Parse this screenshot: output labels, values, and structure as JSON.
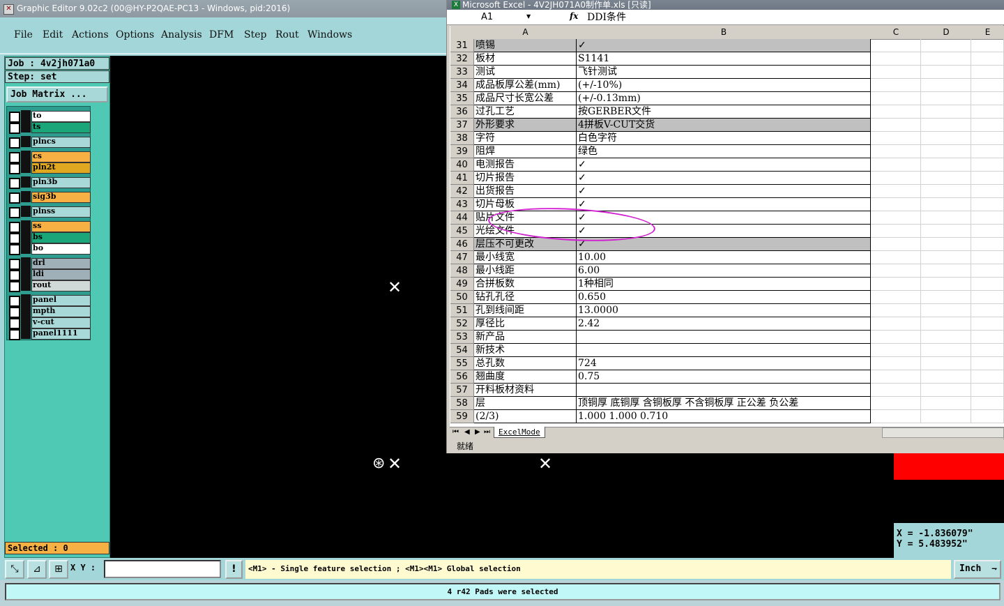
{
  "ge": {
    "title": "Graphic Editor 9.02c2 (00@HY-P2QAE-PC13 - Windows, pid:2016)",
    "menu": [
      "File",
      "Edit",
      "Actions",
      "Options",
      "Analysis",
      "DFM",
      "Step",
      "Rout",
      "Windows"
    ],
    "job": "Job : 4v2jh071a0",
    "step": "Step: set",
    "job_matrix": "Job Matrix ...",
    "layers": [
      {
        "name": "to",
        "color": "#ffffff"
      },
      {
        "name": "ts",
        "color": "#1aa678"
      },
      {
        "name": "plncs",
        "color": "#a8d8d8"
      },
      {
        "name": "cs",
        "color": "#f7b043"
      },
      {
        "name": "pln2t",
        "color": "#e0a820"
      },
      {
        "name": "pln3b",
        "color": "#a8d8d8"
      },
      {
        "name": "sig3b",
        "color": "#f7b043"
      },
      {
        "name": "plnss",
        "color": "#a8d8d8"
      },
      {
        "name": "ss",
        "color": "#f7b043"
      },
      {
        "name": "bs",
        "color": "#1aa678"
      },
      {
        "name": "bo",
        "color": "#ffffff"
      },
      {
        "name": "drl",
        "color": "#a0b0b8"
      },
      {
        "name": "ldi",
        "color": "#a0b0b8"
      },
      {
        "name": "rout",
        "color": "#d0d8d8"
      },
      {
        "name": "panel",
        "color": "#a8d8d8"
      },
      {
        "name": "mpth",
        "color": "#a8d8d8"
      },
      {
        "name": "v-cut",
        "color": "#a8d8d8"
      },
      {
        "name": "panel1111",
        "color": "#a8d8d8"
      }
    ],
    "selected": "Selected : 0",
    "xy_label": "X Y :",
    "hint": "<M1> - Single feature selection ; <M1><M1> Global selection",
    "units": "Inch",
    "message": "4 r42 Pads were selected",
    "coord_x": "X = -1.836079\"",
    "coord_y": "Y = 5.483952\""
  },
  "excel": {
    "title": "Microsoft Excel - 4V2JH071A0制作单.xls [只读]",
    "namebox": "A1",
    "formula": "DDI条件",
    "columns": [
      "A",
      "B",
      "C",
      "D",
      "E"
    ],
    "rows": [
      {
        "n": "31",
        "a": "喷锡",
        "b": "✓",
        "gray": true
      },
      {
        "n": "32",
        "a": "板材",
        "b": "S1141"
      },
      {
        "n": "33",
        "a": "测试",
        "b": "飞针测试"
      },
      {
        "n": "34",
        "a": "成品板厚公差(mm)",
        "b": "(+/-10%)"
      },
      {
        "n": "35",
        "a": "成品尺寸长宽公差",
        "b": "(+/-0.13mm)"
      },
      {
        "n": "36",
        "a": "过孔工艺",
        "b": "按GERBER文件"
      },
      {
        "n": "37",
        "a": "外形要求",
        "b": "4拼板V-CUT交货",
        "gray": true
      },
      {
        "n": "38",
        "a": "字符",
        "b": "白色字符"
      },
      {
        "n": "39",
        "a": "阻焊",
        "b": "绿色"
      },
      {
        "n": "40",
        "a": "电测报告",
        "b": "✓"
      },
      {
        "n": "41",
        "a": "切片报告",
        "b": "✓"
      },
      {
        "n": "42",
        "a": "出货报告",
        "b": "✓"
      },
      {
        "n": "43",
        "a": "切片母板",
        "b": "✓"
      },
      {
        "n": "44",
        "a": "贴片文件",
        "b": "✓"
      },
      {
        "n": "45",
        "a": "光绘文件",
        "b": "✓"
      },
      {
        "n": "46",
        "a": "层压不可更改",
        "b": "✓",
        "gray": true
      },
      {
        "n": "47",
        "a": "最小线宽",
        "b": "10.00"
      },
      {
        "n": "48",
        "a": "最小线距",
        "b": "6.00"
      },
      {
        "n": "49",
        "a": "合拼板数",
        "b": "1种相同"
      },
      {
        "n": "50",
        "a": "钻孔孔径",
        "b": "0.650"
      },
      {
        "n": "51",
        "a": "孔到线间距",
        "b": "13.0000"
      },
      {
        "n": "52",
        "a": "厚径比",
        "b": "2.42"
      },
      {
        "n": "53",
        "a": "新产品",
        "b": ""
      },
      {
        "n": "54",
        "a": "新技术",
        "b": ""
      },
      {
        "n": "55",
        "a": "总孔数",
        "b": "724"
      },
      {
        "n": "56",
        "a": "翘曲度",
        "b": "0.75"
      },
      {
        "n": "57",
        "a": "开料板材资料",
        "b": ""
      },
      {
        "n": "58",
        "a": "层",
        "b": "顶铜厚 底铜厚 含铜板厚 不含铜板厚 正公差 负公差"
      },
      {
        "n": "59",
        "a": "(2/3)",
        "b": "1.000  1.000         0.710"
      }
    ],
    "sheet_tab": "ExcelMode",
    "status": "就绪"
  }
}
